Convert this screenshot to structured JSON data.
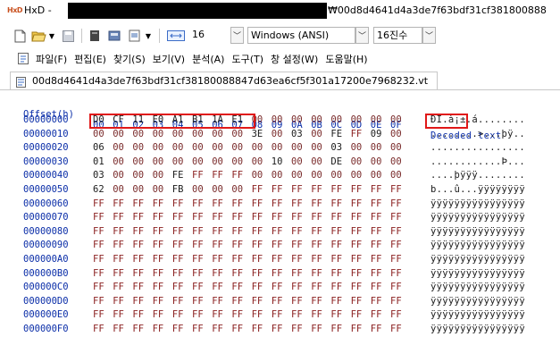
{
  "window": {
    "app_name": "HxD - ",
    "title_visible_tail": "₩00d8d4641d4a3de7f63bdf31cf381800888",
    "logo_text": "HxD"
  },
  "toolbar": {
    "bytes_per_row": "16",
    "charset": "Windows (ANSI)",
    "number_base": "16진수"
  },
  "menu": [
    "파일(F)",
    "편집(E)",
    "찾기(S)",
    "보기(V)",
    "분석(A)",
    "도구(T)",
    "창 설정(W)",
    "도움말(H)"
  ],
  "tab": {
    "label": "00d8d4641d4a3de7f63bdf31cf38180088847d63ea6cf5f301a17200e7968232.vt"
  },
  "hex_view": {
    "header_offset": "Offset(h)",
    "header_columns": [
      "00",
      "01",
      "02",
      "03",
      "04",
      "05",
      "06",
      "07",
      "08",
      "09",
      "0A",
      "0B",
      "0C",
      "0D",
      "0E",
      "0F"
    ],
    "header_decoded": "Decoded text",
    "rows": [
      {
        "offset": "00000000",
        "bytes": [
          "D0",
          "CF",
          "11",
          "E0",
          "A1",
          "B1",
          "1A",
          "E1",
          "00",
          "00",
          "00",
          "00",
          "00",
          "00",
          "00",
          "00"
        ],
        "decoded": "ÐÏ.à¡±.á........"
      },
      {
        "offset": "00000010",
        "bytes": [
          "00",
          "00",
          "00",
          "00",
          "00",
          "00",
          "00",
          "00",
          "3E",
          "00",
          "03",
          "00",
          "FE",
          "FF",
          "09",
          "00"
        ],
        "decoded": "........>...þÿ.."
      },
      {
        "offset": "00000020",
        "bytes": [
          "06",
          "00",
          "00",
          "00",
          "00",
          "00",
          "00",
          "00",
          "00",
          "00",
          "00",
          "00",
          "03",
          "00",
          "00",
          "00"
        ],
        "decoded": "................"
      },
      {
        "offset": "00000030",
        "bytes": [
          "01",
          "00",
          "00",
          "00",
          "00",
          "00",
          "00",
          "00",
          "00",
          "10",
          "00",
          "00",
          "DE",
          "00",
          "00",
          "00"
        ],
        "decoded": "............Þ..."
      },
      {
        "offset": "00000040",
        "bytes": [
          "03",
          "00",
          "00",
          "00",
          "FE",
          "FF",
          "FF",
          "FF",
          "00",
          "00",
          "00",
          "00",
          "00",
          "00",
          "00",
          "00"
        ],
        "decoded": "....þÿÿÿ........"
      },
      {
        "offset": "00000050",
        "bytes": [
          "62",
          "00",
          "00",
          "00",
          "FB",
          "00",
          "00",
          "00",
          "FF",
          "FF",
          "FF",
          "FF",
          "FF",
          "FF",
          "FF",
          "FF"
        ],
        "decoded": "b...û...ÿÿÿÿÿÿÿÿ"
      },
      {
        "offset": "00000060",
        "bytes": [
          "FF",
          "FF",
          "FF",
          "FF",
          "FF",
          "FF",
          "FF",
          "FF",
          "FF",
          "FF",
          "FF",
          "FF",
          "FF",
          "FF",
          "FF",
          "FF"
        ],
        "decoded": "ÿÿÿÿÿÿÿÿÿÿÿÿÿÿÿÿ"
      },
      {
        "offset": "00000070",
        "bytes": [
          "FF",
          "FF",
          "FF",
          "FF",
          "FF",
          "FF",
          "FF",
          "FF",
          "FF",
          "FF",
          "FF",
          "FF",
          "FF",
          "FF",
          "FF",
          "FF"
        ],
        "decoded": "ÿÿÿÿÿÿÿÿÿÿÿÿÿÿÿÿ"
      },
      {
        "offset": "00000080",
        "bytes": [
          "FF",
          "FF",
          "FF",
          "FF",
          "FF",
          "FF",
          "FF",
          "FF",
          "FF",
          "FF",
          "FF",
          "FF",
          "FF",
          "FF",
          "FF",
          "FF"
        ],
        "decoded": "ÿÿÿÿÿÿÿÿÿÿÿÿÿÿÿÿ"
      },
      {
        "offset": "00000090",
        "bytes": [
          "FF",
          "FF",
          "FF",
          "FF",
          "FF",
          "FF",
          "FF",
          "FF",
          "FF",
          "FF",
          "FF",
          "FF",
          "FF",
          "FF",
          "FF",
          "FF"
        ],
        "decoded": "ÿÿÿÿÿÿÿÿÿÿÿÿÿÿÿÿ"
      },
      {
        "offset": "000000A0",
        "bytes": [
          "FF",
          "FF",
          "FF",
          "FF",
          "FF",
          "FF",
          "FF",
          "FF",
          "FF",
          "FF",
          "FF",
          "FF",
          "FF",
          "FF",
          "FF",
          "FF"
        ],
        "decoded": "ÿÿÿÿÿÿÿÿÿÿÿÿÿÿÿÿ"
      },
      {
        "offset": "000000B0",
        "bytes": [
          "FF",
          "FF",
          "FF",
          "FF",
          "FF",
          "FF",
          "FF",
          "FF",
          "FF",
          "FF",
          "FF",
          "FF",
          "FF",
          "FF",
          "FF",
          "FF"
        ],
        "decoded": "ÿÿÿÿÿÿÿÿÿÿÿÿÿÿÿÿ"
      },
      {
        "offset": "000000C0",
        "bytes": [
          "FF",
          "FF",
          "FF",
          "FF",
          "FF",
          "FF",
          "FF",
          "FF",
          "FF",
          "FF",
          "FF",
          "FF",
          "FF",
          "FF",
          "FF",
          "FF"
        ],
        "decoded": "ÿÿÿÿÿÿÿÿÿÿÿÿÿÿÿÿ"
      },
      {
        "offset": "000000D0",
        "bytes": [
          "FF",
          "FF",
          "FF",
          "FF",
          "FF",
          "FF",
          "FF",
          "FF",
          "FF",
          "FF",
          "FF",
          "FF",
          "FF",
          "FF",
          "FF",
          "FF"
        ],
        "decoded": "ÿÿÿÿÿÿÿÿÿÿÿÿÿÿÿÿ"
      },
      {
        "offset": "000000E0",
        "bytes": [
          "FF",
          "FF",
          "FF",
          "FF",
          "FF",
          "FF",
          "FF",
          "FF",
          "FF",
          "FF",
          "FF",
          "FF",
          "FF",
          "FF",
          "FF",
          "FF"
        ],
        "decoded": "ÿÿÿÿÿÿÿÿÿÿÿÿÿÿÿÿ"
      },
      {
        "offset": "000000F0",
        "bytes": [
          "FF",
          "FF",
          "FF",
          "FF",
          "FF",
          "FF",
          "FF",
          "FF",
          "FF",
          "FF",
          "FF",
          "FF",
          "FF",
          "FF",
          "FF",
          "FF"
        ],
        "decoded": "ÿÿÿÿÿÿÿÿÿÿÿÿÿÿÿÿ"
      }
    ]
  },
  "colors": {
    "header_blue": "#0b2ea8",
    "highlight_red": "#e01818",
    "byte_color": "#8b2020"
  }
}
